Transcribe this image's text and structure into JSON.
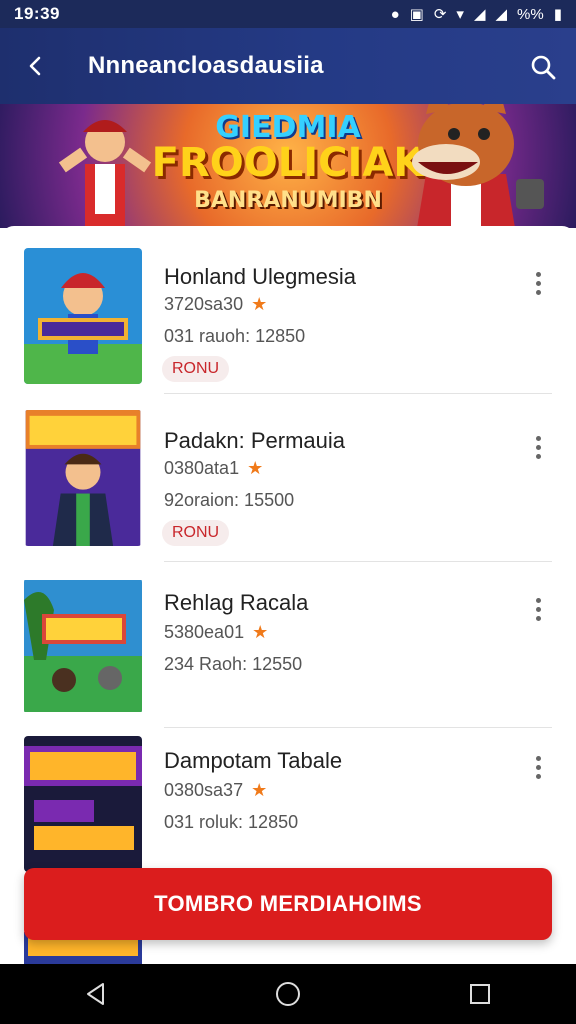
{
  "status_bar": {
    "time": "19:39",
    "battery": "%%"
  },
  "app_bar": {
    "title": "Nnneancloasdausiia"
  },
  "hero": {
    "line1": "GIEDMIA",
    "line2": "FROOLICIAK",
    "line3": "BANRANUMIBN"
  },
  "games": [
    {
      "name": "Honland Ulegmesia",
      "rating_line": "3720sa30",
      "sub_line": "031 rauoh: 12850",
      "badge": "RONU",
      "thumb_colors": [
        "#2a8fd6",
        "#4fb64a",
        "#f2b233"
      ]
    },
    {
      "name": "Padakn: Permauia",
      "rating_line": "0380ata1",
      "sub_line": "92oraion: 15500",
      "badge": "RONU",
      "thumb_colors": [
        "#4a2a9a",
        "#e8802a",
        "#ffd23a"
      ]
    },
    {
      "name": "Rehlag Racala",
      "rating_line": "5380ea01",
      "sub_line": "234 Raoh: 12550",
      "badge": "",
      "thumb_colors": [
        "#2f8fd0",
        "#3aa84a",
        "#d9473a"
      ]
    },
    {
      "name": "Dampotam Tabale",
      "rating_line": "0380sa37",
      "sub_line": "031 roluk: 12850",
      "badge": "",
      "thumb_colors": [
        "#1a1a3a",
        "#7a2ab0",
        "#ffb52a"
      ]
    }
  ],
  "cta": {
    "label": "TOMBRO MERDIAHOIMS"
  },
  "colors": {
    "app_bar": "#243a85",
    "accent": "#db1d1d",
    "star": "#f07a1a",
    "badge_text": "#c8262b"
  }
}
